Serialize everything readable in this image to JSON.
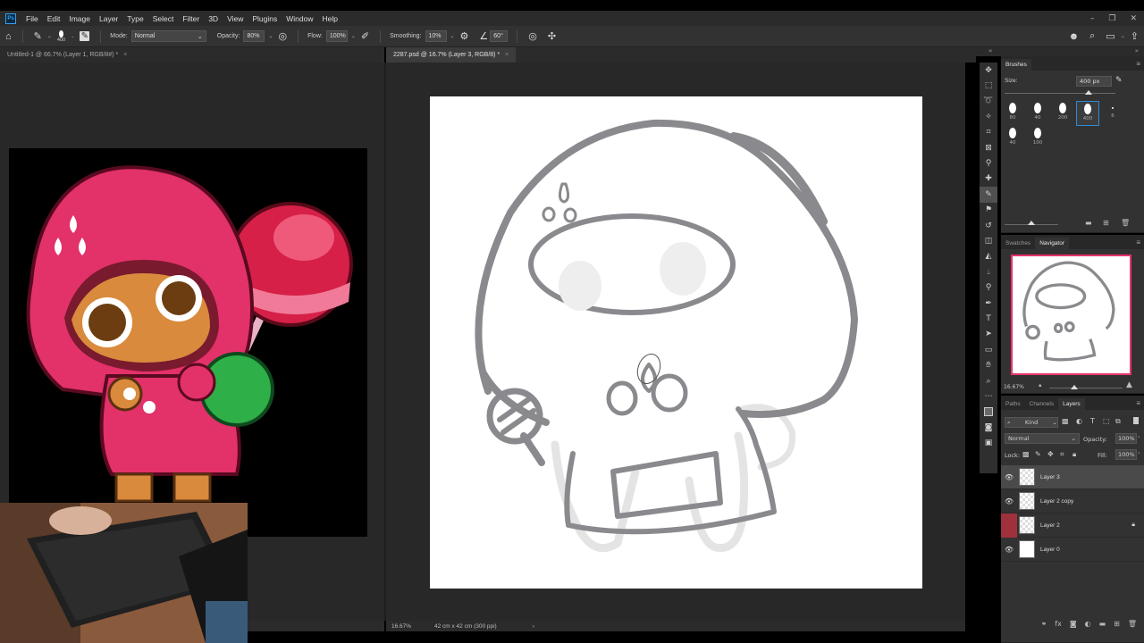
{
  "menu": {
    "logo": "Ps",
    "items": [
      "File",
      "Edit",
      "Image",
      "Layer",
      "Type",
      "Select",
      "Filter",
      "3D",
      "View",
      "Plugins",
      "Window",
      "Help"
    ]
  },
  "window_controls": {
    "minimize": "–",
    "restore": "❐",
    "close": "✕"
  },
  "options": {
    "mode_label": "Mode:",
    "mode_value": "Normal",
    "opacity_label": "Opacity:",
    "opacity_value": "80%",
    "flow_label": "Flow:",
    "flow_value": "100%",
    "smoothing_label": "Smoothing:",
    "smoothing_value": "10%",
    "angle_value": "60°",
    "brush_size": "400"
  },
  "tabs": {
    "left": {
      "label": "Untitled-1 @ 66.7% (Layer 1, RGB/8#) *",
      "close": "×"
    },
    "right": {
      "label": "2287.psd @ 16.7% (Layer 3, RGB/8) *",
      "close": "×"
    }
  },
  "status": {
    "zoom": "16.67%",
    "doc_size": "42 cm x 42 cm (300 ppi)",
    "arrow": "›"
  },
  "brushes_panel": {
    "tab": "Brushes",
    "size_label": "Size:",
    "size_value": "400 px",
    "presets": [
      "80",
      "40",
      "200",
      "400",
      "6",
      "40",
      "100"
    ]
  },
  "navigator_panel": {
    "tabs": [
      "Swatches",
      "Navigator"
    ],
    "zoom": "16.67%"
  },
  "layers_panel": {
    "tabs": [
      "Paths",
      "Channels",
      "Layers"
    ],
    "filter_kind": "Kind",
    "blend_mode": "Normal",
    "opacity_label": "Opacity:",
    "opacity_value": "100%",
    "lock_label": "Lock:",
    "fill_label": "Fill:",
    "fill_value": "100%",
    "layers": [
      {
        "name": "Layer 3",
        "selected": true
      },
      {
        "name": "Layer 2 copy",
        "selected": false
      },
      {
        "name": "Layer 2",
        "selected": false,
        "locked": true
      },
      {
        "name": "Layer 0",
        "selected": false
      }
    ]
  },
  "colors": {
    "ui_dark": "#2b2b2b",
    "panel": "#323232",
    "canvas_bg": "#282828",
    "accent_pink": "#e8336b"
  }
}
